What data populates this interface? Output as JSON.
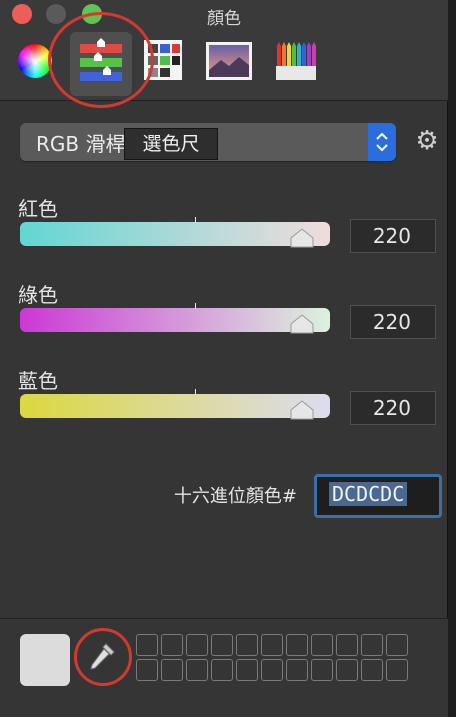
{
  "window": {
    "title": "顏色"
  },
  "toolbar": {
    "tabs": [
      {
        "name": "color-wheel",
        "icon": "color-wheel-icon"
      },
      {
        "name": "color-sliders",
        "icon": "sliders-icon",
        "selected": true
      },
      {
        "name": "color-palettes",
        "icon": "palette-icon"
      },
      {
        "name": "image-palettes",
        "icon": "image-icon"
      },
      {
        "name": "pencils",
        "icon": "pencils-icon"
      }
    ]
  },
  "slider_mode": {
    "label": "RGB 滑桿",
    "tooltip": "選色尺"
  },
  "sliders": {
    "red": {
      "label": "紅色",
      "value": "220"
    },
    "green": {
      "label": "綠色",
      "value": "220"
    },
    "blue": {
      "label": "藍色",
      "value": "220"
    }
  },
  "hex": {
    "label": "十六進位顏色#",
    "value": "DCDCDC"
  },
  "current_color": "#dcdcdc",
  "colors": {
    "accent": "#2a6ddc",
    "annotation_circle": "#d33a2f"
  }
}
